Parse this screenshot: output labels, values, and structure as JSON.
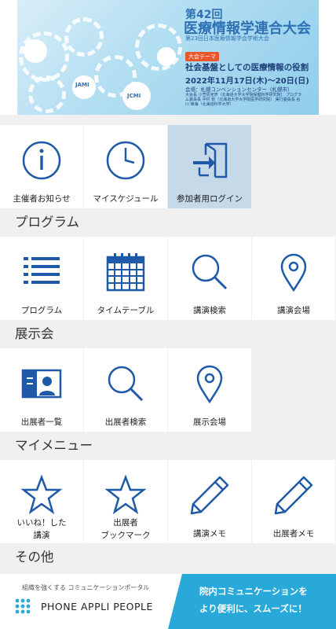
{
  "banner": {
    "edition": "第42回",
    "title": "医療情報学連合大会",
    "subtitle": "第23回日本医療情報学会学術大会",
    "theme_label": "大会テーマ",
    "theme": "社会基盤としての医療情報の役割",
    "date": "2022年11月17日(木)～20日(日)",
    "venue": "会場：札幌コンベンションセンター（札幌市）",
    "people": "大会長 小笠原克彦（北海道大学大学院保健科学研究院） プログラム委員長 中村 稔（北海道大学大学院医学研究院） 実行委員長 谷川 琢海（北海道科学大学）",
    "jami": "JAMI",
    "jcmi": "JCMI"
  },
  "top_tiles": [
    {
      "label": "主催者お知らせ",
      "icon": "info-icon"
    },
    {
      "label": "マイスケジュール",
      "icon": "clock-icon"
    },
    {
      "label": "参加者用ログイン",
      "icon": "login-icon"
    }
  ],
  "sections": [
    {
      "title": "プログラム",
      "tiles": [
        {
          "label": "プログラム",
          "icon": "list-icon"
        },
        {
          "label": "タイムテーブル",
          "icon": "calendar-icon"
        },
        {
          "label": "講演検索",
          "icon": "search-icon"
        },
        {
          "label": "講演会場",
          "icon": "map-pin-icon"
        }
      ]
    },
    {
      "title": "展示会",
      "tiles": [
        {
          "label": "出展者一覧",
          "icon": "exhibitor-icon"
        },
        {
          "label": "出展者検索",
          "icon": "search-icon"
        },
        {
          "label": "展示会場",
          "icon": "map-pin-icon"
        }
      ]
    },
    {
      "title": "マイメニュー",
      "tiles": [
        {
          "label1": "いいね！した",
          "label2": "講演",
          "icon": "star-icon"
        },
        {
          "label1": "出展者",
          "label2": "ブックマーク",
          "icon": "star-icon"
        },
        {
          "label": "講演メモ",
          "icon": "pencil-icon"
        },
        {
          "label": "出展者メモ",
          "icon": "pencil-icon"
        }
      ]
    },
    {
      "title": "その他"
    }
  ],
  "ad": {
    "tagline": "組織を強くする コミュニケーションポータル",
    "brand": "PHONE APPLI PEOPLE",
    "message1": "院内コミュニケーションを",
    "message2": "より便利に、スムーズに！"
  },
  "colors": {
    "icon": "#1e5aa8",
    "active_tile": "#c5d9e8",
    "ad_accent": "#29a9d9"
  }
}
